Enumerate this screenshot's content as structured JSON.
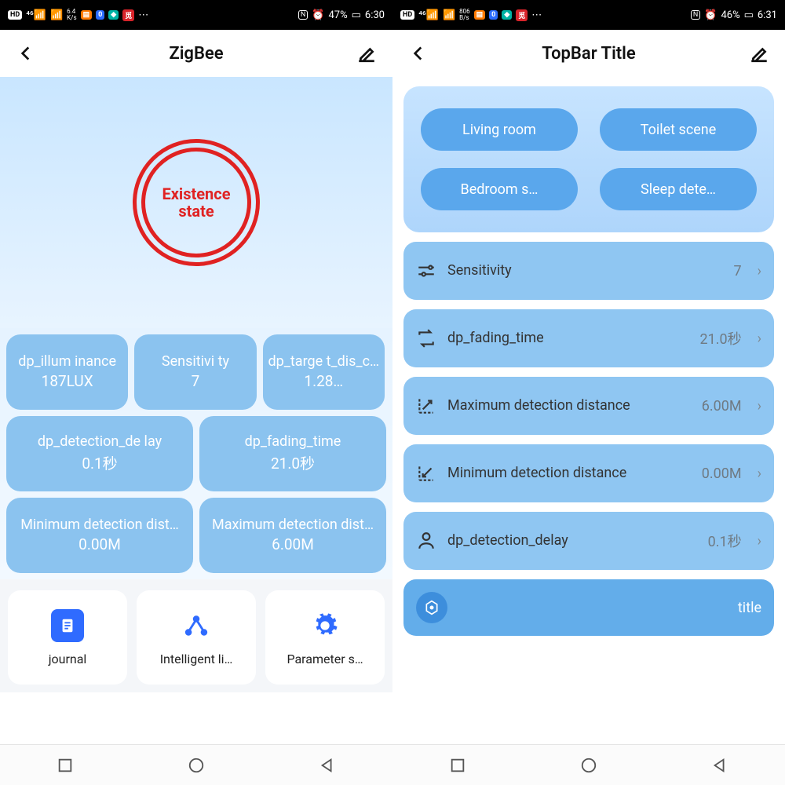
{
  "left": {
    "status": {
      "net": "6.4",
      "netUnit": "K/s",
      "battery": "47%",
      "time": "6:30"
    },
    "title": "ZigBee",
    "state_label": "Existence state",
    "tiles": [
      {
        "label": "dp_illum inance",
        "value": "187LUX"
      },
      {
        "label": "Sensitivi ty",
        "value": "7"
      },
      {
        "label": "dp_targe t_dis_c…",
        "value": "1.28…"
      },
      {
        "label": "dp_detection_de lay",
        "value": "0.1秒"
      },
      {
        "label": "dp_fading_time",
        "value": "21.0秒"
      },
      {
        "label": "Minimum detection dist…",
        "value": "0.00M"
      },
      {
        "label": "Maximum detection dist…",
        "value": "6.00M"
      }
    ],
    "actions": [
      {
        "label": "journal"
      },
      {
        "label": "Intelligent li…"
      },
      {
        "label": "Parameter s…"
      }
    ]
  },
  "right": {
    "status": {
      "net": "806",
      "netUnit": "B/s",
      "battery": "46%",
      "time": "6:31"
    },
    "title": "TopBar Title",
    "scenes": [
      "Living room",
      "Toilet scene",
      "Bedroom s…",
      "Sleep dete…"
    ],
    "settings": [
      {
        "label": "Sensitivity",
        "value": "7"
      },
      {
        "label": "dp_fading_time",
        "value": "21.0秒"
      },
      {
        "label": "Maximum detection distance",
        "value": "6.00M"
      },
      {
        "label": "Minimum detection distance",
        "value": "0.00M"
      },
      {
        "label": "dp_detection_delay",
        "value": "0.1秒"
      }
    ],
    "titleRow": "title"
  }
}
